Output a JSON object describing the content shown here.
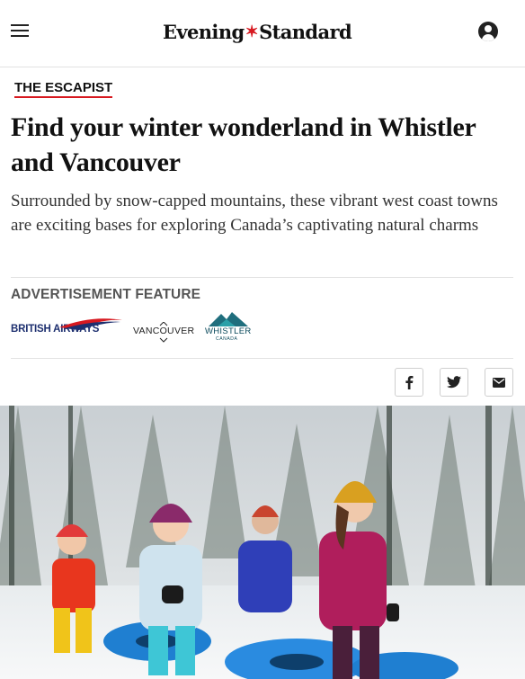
{
  "header": {
    "logo_left": "Evening",
    "logo_right": "Standard",
    "menu_icon": "hamburger-menu-icon",
    "account_icon": "user-account-icon"
  },
  "article": {
    "section": "THE ESCAPIST",
    "headline": "Find your winter wonderland in Whistler and Vancouver",
    "standfirst": "Surrounded by snow-capped mountains, these vibrant west coast towns are exciting bases for exploring Canada’s captivating natural charms",
    "ad_label": "ADVERTISEMENT FEATURE"
  },
  "sponsors": {
    "british_airways": "BRITISH AIRWAYS",
    "vancouver": "VANCOUVER",
    "whistler": "WHISTLER",
    "whistler_sub": "CANADA"
  },
  "share": {
    "facebook_icon": "facebook-icon",
    "twitter_icon": "twitter-icon",
    "email_icon": "email-icon"
  },
  "colors": {
    "brand_red": "#d71920",
    "ba_blue": "#1d2f6f",
    "whistler_teal": "#0b4a5c"
  }
}
